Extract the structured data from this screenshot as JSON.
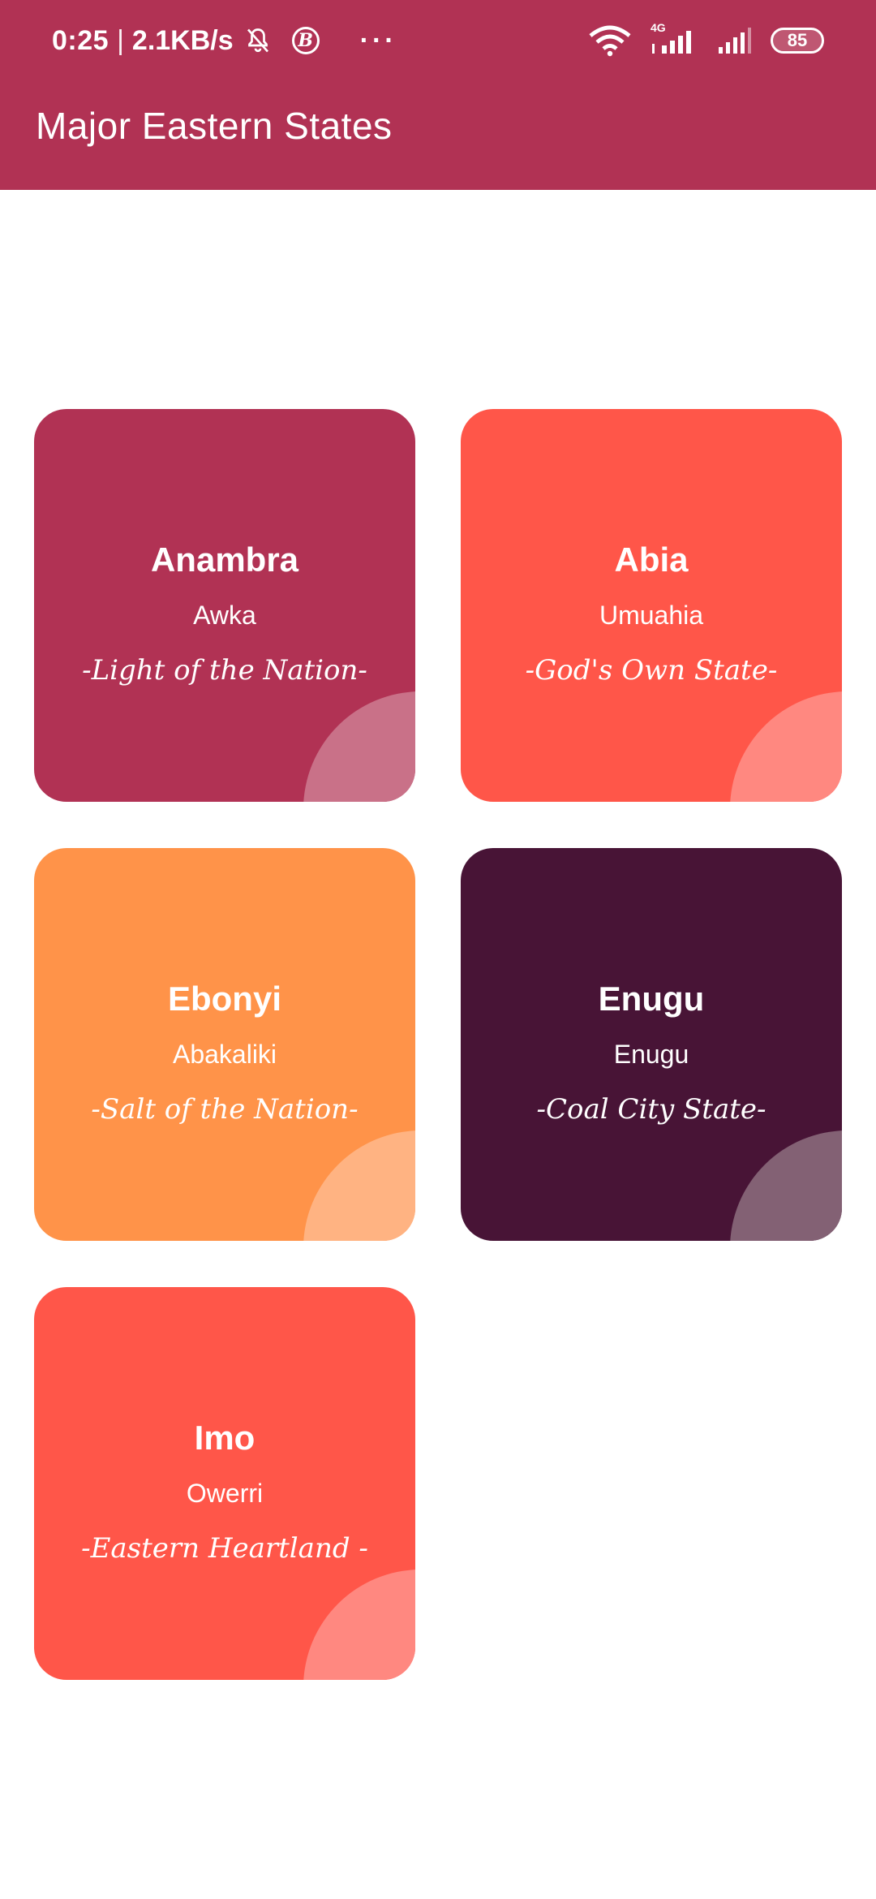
{
  "status_bar": {
    "time": "0:25",
    "separator": "|",
    "net_speed": "2.1KB/s",
    "network_type": "4G",
    "battery": "85",
    "more": "···",
    "b_icon_label": "B"
  },
  "app_bar": {
    "title": "Major Eastern States"
  },
  "states": [
    {
      "name": "Anambra",
      "capital": "Awka",
      "slogan": "-Light of the Nation-",
      "color": "#b13254",
      "accent": "#c97188"
    },
    {
      "name": "Abia",
      "capital": "Umuahia",
      "slogan": "-God's Own State-",
      "color": "#ff5649",
      "accent": "#ff8880"
    },
    {
      "name": "Ebonyi",
      "capital": "Abakaliki",
      "slogan": "-Salt of the Nation-",
      "color": "#ff9349",
      "accent": "#ffb382"
    },
    {
      "name": "Enugu",
      "capital": "Enugu",
      "slogan": "-Coal City State-",
      "color": "#481436",
      "accent": "#836174"
    },
    {
      "name": "Imo",
      "capital": "Owerri",
      "slogan": "-Eastern Heartland -",
      "color": "#ff5649",
      "accent": "#ff8880"
    }
  ],
  "colors": {
    "app_bar": "#b13254",
    "background": "#ffffff"
  }
}
